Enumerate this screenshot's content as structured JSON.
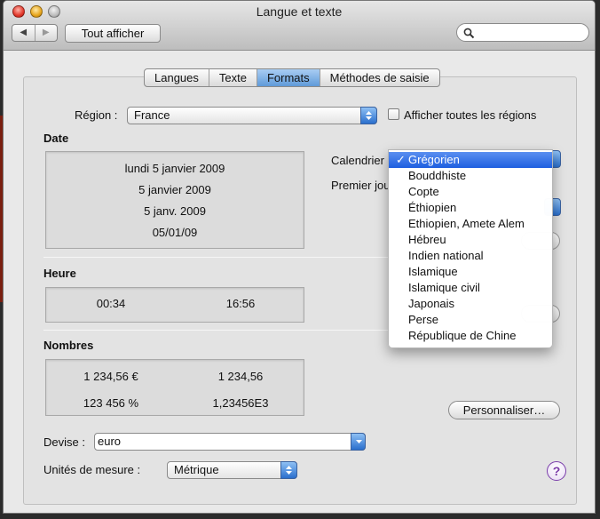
{
  "window": {
    "title": "Langue et texte"
  },
  "toolbar": {
    "back_icon": "◀",
    "forward_icon": "▶",
    "show_all_label": "Tout afficher",
    "search_placeholder": ""
  },
  "tabs": [
    {
      "label": "Langues",
      "active": false
    },
    {
      "label": "Texte",
      "active": false
    },
    {
      "label": "Formats",
      "active": true
    },
    {
      "label": "Méthodes de saisie",
      "active": false
    }
  ],
  "region": {
    "label": "Région :",
    "value": "France",
    "show_all_label": "Afficher toutes les régions",
    "show_all_checked": false
  },
  "date": {
    "heading": "Date",
    "samples": [
      "lundi 5 janvier 2009",
      "5 janvier 2009",
      "5 janv. 2009",
      "05/01/09"
    ],
    "calendar_label": "Calendrier",
    "first_day_label": "Premier jou"
  },
  "calendar_menu": {
    "selected": "Grégorien",
    "check_icon": "✓",
    "items": [
      "Grégorien",
      "Bouddhiste",
      "Copte",
      "Éthiopien",
      "Ethiopien, Amete Alem",
      "Hébreu",
      "Indien national",
      "Islamique",
      "Islamique civil",
      "Japonais",
      "Perse",
      "République de Chine"
    ]
  },
  "time": {
    "heading": "Heure",
    "short": "00:34",
    "long": "16:56"
  },
  "numbers": {
    "heading": "Nombres",
    "currency_sample": "1 234,56 €",
    "decimal_sample": "1 234,56",
    "percent_sample": "123 456 %",
    "scientific_sample": "1,23456E3",
    "customize_label": "Personnaliser…"
  },
  "currency": {
    "label": "Devise :",
    "value": "euro"
  },
  "units": {
    "label": "Unités de mesure :",
    "value": "Métrique"
  },
  "help": {
    "label": "?"
  },
  "colors": {
    "accent": "#2a6fcd",
    "menu_highlight": "#1e5fe0",
    "help": "#7b3aa8"
  }
}
